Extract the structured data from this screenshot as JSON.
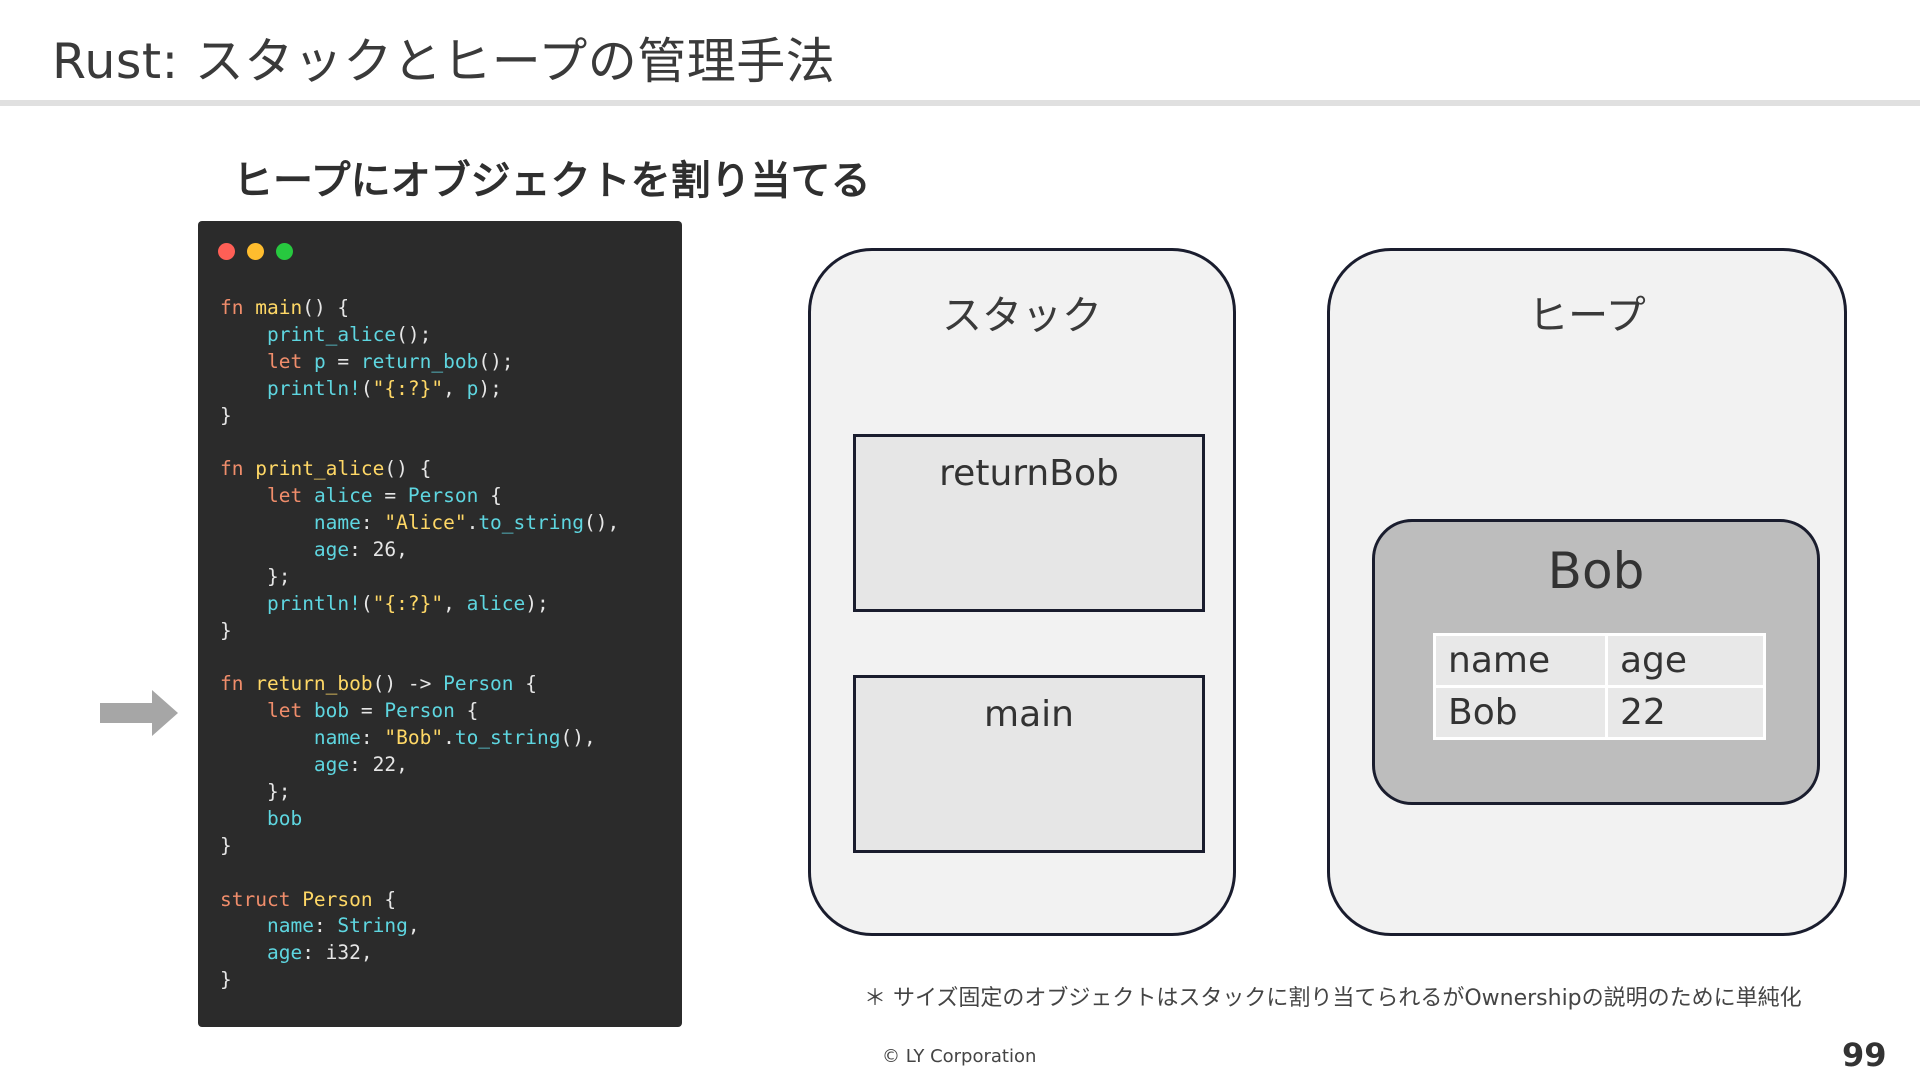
{
  "slide": {
    "title": "Rust: スタックとヒープの管理手法",
    "subtitle": "ヒープにオブジェクトを割り当てる",
    "footnote": "＊ サイズ固定のオブジェクトはスタックに割り当てられるがOwnershipの説明のために単純化",
    "copyright": "© LY Corporation",
    "page_number": "99"
  },
  "code_window": {
    "controls": [
      "close",
      "minimize",
      "maximize"
    ],
    "lines": [
      [
        {
          "t": "fn ",
          "c": "kw"
        },
        {
          "t": "main",
          "c": "fn"
        },
        {
          "t": "() {",
          "c": "pn"
        }
      ],
      [
        {
          "t": "    ",
          "c": "pn"
        },
        {
          "t": "print_alice",
          "c": "id"
        },
        {
          "t": "();",
          "c": "pn"
        }
      ],
      [
        {
          "t": "    ",
          "c": "pn"
        },
        {
          "t": "let ",
          "c": "kw"
        },
        {
          "t": "p",
          "c": "id"
        },
        {
          "t": " = ",
          "c": "pn"
        },
        {
          "t": "return_bob",
          "c": "id"
        },
        {
          "t": "();",
          "c": "pn"
        }
      ],
      [
        {
          "t": "    ",
          "c": "pn"
        },
        {
          "t": "println!",
          "c": "id"
        },
        {
          "t": "(",
          "c": "pn"
        },
        {
          "t": "\"{:?}\"",
          "c": "str"
        },
        {
          "t": ", ",
          "c": "pn"
        },
        {
          "t": "p",
          "c": "id"
        },
        {
          "t": ");",
          "c": "pn"
        }
      ],
      [
        {
          "t": "}",
          "c": "pn"
        }
      ],
      [],
      [
        {
          "t": "fn ",
          "c": "kw"
        },
        {
          "t": "print_alice",
          "c": "fn"
        },
        {
          "t": "() {",
          "c": "pn"
        }
      ],
      [
        {
          "t": "    ",
          "c": "pn"
        },
        {
          "t": "let ",
          "c": "kw"
        },
        {
          "t": "alice",
          "c": "id"
        },
        {
          "t": " = ",
          "c": "pn"
        },
        {
          "t": "Person",
          "c": "id"
        },
        {
          "t": " {",
          "c": "pn"
        }
      ],
      [
        {
          "t": "        ",
          "c": "pn"
        },
        {
          "t": "name",
          "c": "id"
        },
        {
          "t": ": ",
          "c": "pn"
        },
        {
          "t": "\"Alice\"",
          "c": "str"
        },
        {
          "t": ".",
          "c": "pn"
        },
        {
          "t": "to_string",
          "c": "id"
        },
        {
          "t": "(),",
          "c": "pn"
        }
      ],
      [
        {
          "t": "        ",
          "c": "pn"
        },
        {
          "t": "age",
          "c": "id"
        },
        {
          "t": ": 26,",
          "c": "pn"
        }
      ],
      [
        {
          "t": "    };",
          "c": "pn"
        }
      ],
      [
        {
          "t": "    ",
          "c": "pn"
        },
        {
          "t": "println!",
          "c": "id"
        },
        {
          "t": "(",
          "c": "pn"
        },
        {
          "t": "\"{:?}\"",
          "c": "str"
        },
        {
          "t": ", ",
          "c": "pn"
        },
        {
          "t": "alice",
          "c": "id"
        },
        {
          "t": ");",
          "c": "pn"
        }
      ],
      [
        {
          "t": "}",
          "c": "pn"
        }
      ],
      [],
      [
        {
          "t": "fn ",
          "c": "kw"
        },
        {
          "t": "return_bob",
          "c": "fn"
        },
        {
          "t": "() -> ",
          "c": "pn"
        },
        {
          "t": "Person",
          "c": "id"
        },
        {
          "t": " {",
          "c": "pn"
        }
      ],
      [
        {
          "t": "    ",
          "c": "pn"
        },
        {
          "t": "let ",
          "c": "kw"
        },
        {
          "t": "bob",
          "c": "id"
        },
        {
          "t": " = ",
          "c": "pn"
        },
        {
          "t": "Person",
          "c": "id"
        },
        {
          "t": " {",
          "c": "pn"
        }
      ],
      [
        {
          "t": "        ",
          "c": "pn"
        },
        {
          "t": "name",
          "c": "id"
        },
        {
          "t": ": ",
          "c": "pn"
        },
        {
          "t": "\"Bob\"",
          "c": "str"
        },
        {
          "t": ".",
          "c": "pn"
        },
        {
          "t": "to_string",
          "c": "id"
        },
        {
          "t": "(),",
          "c": "pn"
        }
      ],
      [
        {
          "t": "        ",
          "c": "pn"
        },
        {
          "t": "age",
          "c": "id"
        },
        {
          "t": ": 22,",
          "c": "pn"
        }
      ],
      [
        {
          "t": "    };",
          "c": "pn"
        }
      ],
      [
        {
          "t": "    ",
          "c": "pn"
        },
        {
          "t": "bob",
          "c": "id"
        }
      ],
      [
        {
          "t": "}",
          "c": "pn"
        }
      ],
      [],
      [
        {
          "t": "struct ",
          "c": "kw"
        },
        {
          "t": "Person",
          "c": "ty"
        },
        {
          "t": " {",
          "c": "pn"
        }
      ],
      [
        {
          "t": "    ",
          "c": "pn"
        },
        {
          "t": "name",
          "c": "id"
        },
        {
          "t": ": ",
          "c": "pn"
        },
        {
          "t": "String",
          "c": "id"
        },
        {
          "t": ",",
          "c": "pn"
        }
      ],
      [
        {
          "t": "    ",
          "c": "pn"
        },
        {
          "t": "age",
          "c": "id"
        },
        {
          "t": ": i32,",
          "c": "pn"
        }
      ],
      [
        {
          "t": "}",
          "c": "pn"
        }
      ]
    ]
  },
  "stack": {
    "title": "スタック",
    "frames": [
      "returnBob",
      "main"
    ]
  },
  "heap": {
    "title": "ヒープ",
    "object": {
      "title": "Bob",
      "headers": [
        "name",
        "age"
      ],
      "values": [
        "Bob",
        "22"
      ]
    }
  }
}
